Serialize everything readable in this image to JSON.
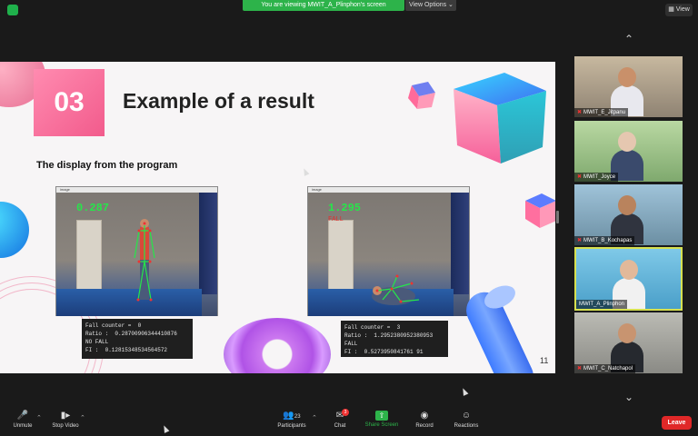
{
  "topbar": {
    "share_banner": "You are viewing MWIT_A_Plinphon's screen",
    "view_options": "View Options ⌄",
    "view_button": "View"
  },
  "slide": {
    "number": "03",
    "title": "Example of a result",
    "subtitle": "The display from the program",
    "page_number": "11",
    "window_title": "image",
    "left": {
      "ratio_overlay": "0.287",
      "console": [
        "Fall counter =  0",
        "Ratio :  0.28700906344410876",
        "NO FALL",
        "FI :  0.12815348534564572"
      ]
    },
    "right": {
      "ratio_overlay": "1.295",
      "fall_overlay": "FALL",
      "console": [
        "Fall counter =  3",
        "Ratio :  1.2952380952380953",
        "FALL",
        "FI :  0.5273950841761 91"
      ]
    }
  },
  "gallery": {
    "tiles": [
      {
        "name": "MWIT_E_Jitpanu",
        "muted": true
      },
      {
        "name": "MWIT_Joyce",
        "muted": true
      },
      {
        "name": "MWIT_B_Kochapas",
        "muted": true
      },
      {
        "name": "MWIT_A_Plinphon",
        "muted": false
      },
      {
        "name": "MWIT_C_Natchapol",
        "muted": true
      }
    ]
  },
  "toolbar": {
    "unmute": "Unmute",
    "stop_video": "Stop Video",
    "participants": "Participants",
    "participants_count": "23",
    "chat": "Chat",
    "chat_badge": "3",
    "share_screen": "Share Screen",
    "record": "Record",
    "reactions": "Reactions",
    "leave": "Leave"
  },
  "colors": {
    "share_green": "#2db34a",
    "leave_red": "#e02828",
    "active_speaker": "#d6e050",
    "overlay_green": "#26e64a",
    "overlay_red": "#e52b2b"
  }
}
